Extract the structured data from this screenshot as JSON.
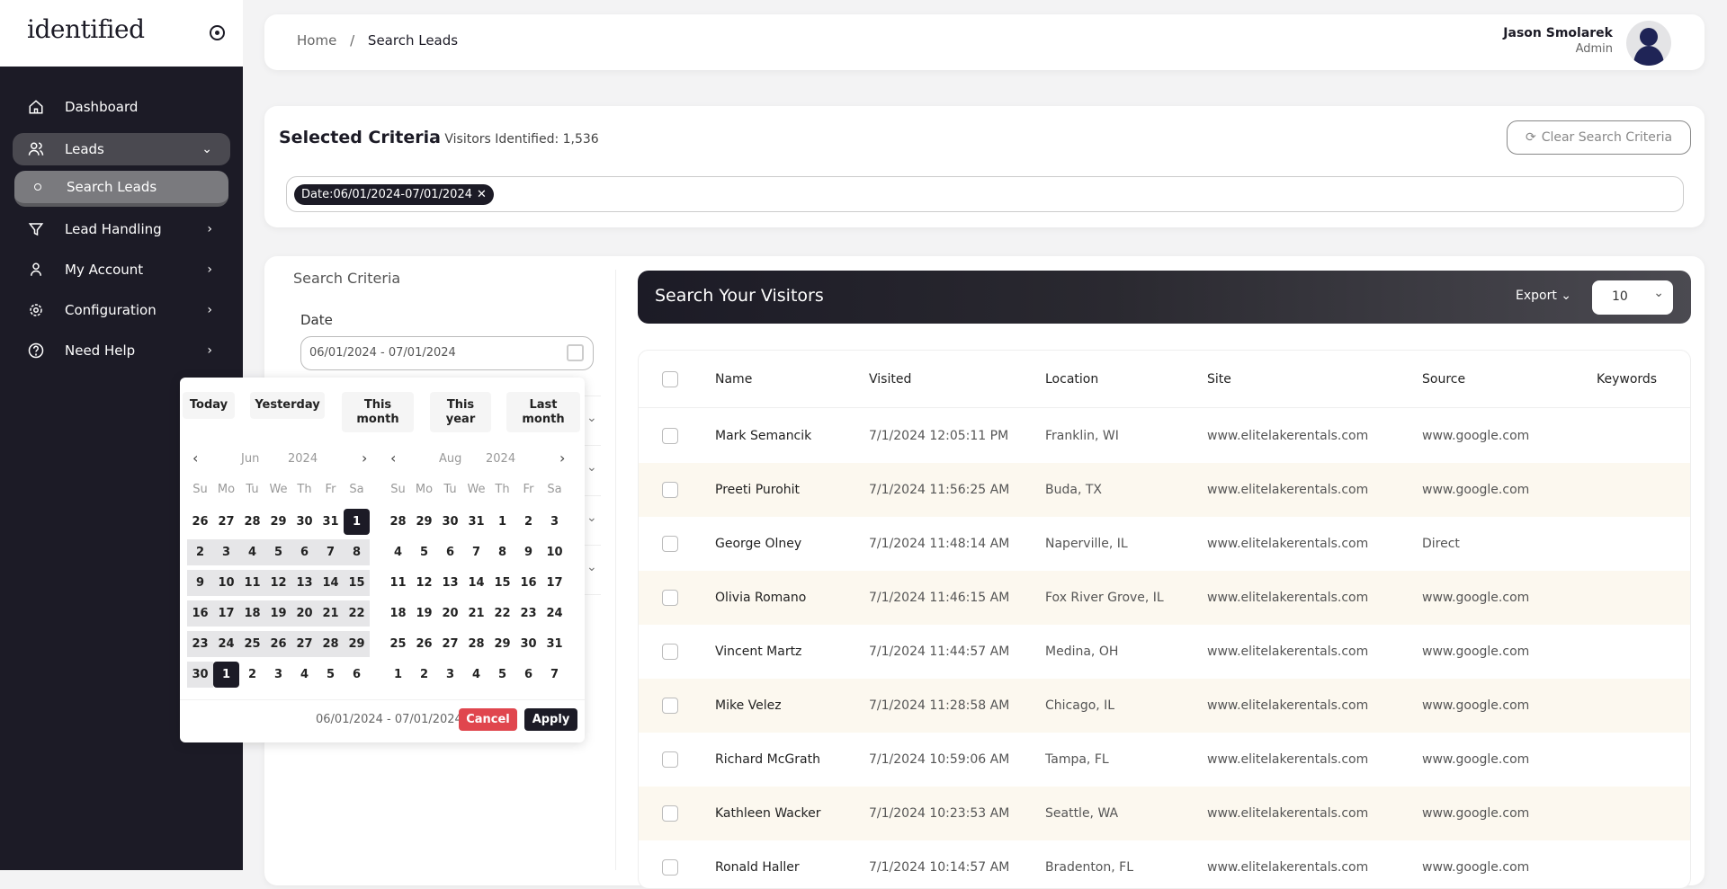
{
  "app": {
    "logo": "identified"
  },
  "sidebar": {
    "items": [
      {
        "label": "Dashboard",
        "icon": "home-icon"
      },
      {
        "label": "Leads",
        "icon": "users-icon",
        "expanded": true
      },
      {
        "label": "Search Leads",
        "icon": "circle-icon",
        "active": true
      },
      {
        "label": "Lead Handling",
        "icon": "filter-icon"
      },
      {
        "label": "My Account",
        "icon": "user-icon"
      },
      {
        "label": "Configuration",
        "icon": "gear-icon"
      },
      {
        "label": "Need Help",
        "icon": "help-icon"
      }
    ]
  },
  "header": {
    "breadcrumb": [
      "Home",
      "Search Leads"
    ],
    "separator": "/",
    "user_name": "Jason Smolarek",
    "user_role": "Admin"
  },
  "criteria": {
    "title": "Selected Criteria",
    "count_label": "Visitors Identified: 1,536",
    "clear_label": "Clear Search Criteria",
    "chips": [
      {
        "label": "Date:06/01/2024-07/01/2024",
        "remove": "✕"
      }
    ]
  },
  "search_panel": {
    "title": "Search Criteria",
    "date_label": "Date",
    "date_value": "06/01/2024 - 07/01/2024"
  },
  "datepicker": {
    "presets": [
      "Today",
      "Yesterday",
      "This month",
      "This year",
      "Last month"
    ],
    "weekdays": [
      "Su",
      "Mo",
      "Tu",
      "We",
      "Th",
      "Fr",
      "Sa"
    ],
    "calendars": [
      {
        "month": "Jun",
        "year": "2024",
        "weeks": [
          [
            26,
            27,
            28,
            29,
            30,
            31,
            1
          ],
          [
            2,
            3,
            4,
            5,
            6,
            7,
            8
          ],
          [
            9,
            10,
            11,
            12,
            13,
            14,
            15
          ],
          [
            16,
            17,
            18,
            19,
            20,
            21,
            22
          ],
          [
            23,
            24,
            25,
            26,
            27,
            28,
            29
          ],
          [
            30,
            1,
            2,
            3,
            4,
            5,
            6
          ]
        ]
      },
      {
        "month": "Aug",
        "year": "2024",
        "weeks": [
          [
            28,
            29,
            30,
            31,
            1,
            2,
            3
          ],
          [
            4,
            5,
            6,
            7,
            8,
            9,
            10
          ],
          [
            11,
            12,
            13,
            14,
            15,
            16,
            17
          ],
          [
            18,
            19,
            20,
            21,
            22,
            23,
            24
          ],
          [
            25,
            26,
            27,
            28,
            29,
            30,
            31
          ],
          [
            1,
            2,
            3,
            4,
            5,
            6,
            7
          ]
        ]
      }
    ],
    "range_start": "2024-06-01",
    "range_end": "2024-07-01",
    "range_text": "06/01/2024 - 07/01/2024",
    "cancel_label": "Cancel",
    "apply_label": "Apply",
    "colors": {
      "cancel": "#e0464e",
      "apply": "#1c1b26"
    }
  },
  "visitors": {
    "title": "Search Your Visitors",
    "export_label": "Export",
    "page_size": "10",
    "columns": [
      "Name",
      "Visited",
      "Location",
      "Site",
      "Source",
      "Keywords"
    ],
    "rows": [
      [
        "Mark Semancik",
        "7/1/2024 12:05:11 PM",
        "Franklin, WI",
        "www.elitelakerentals.com",
        "www.google.com",
        ""
      ],
      [
        "Preeti Purohit",
        "7/1/2024 11:56:25 AM",
        "Buda, TX",
        "www.elitelakerentals.com",
        "www.google.com",
        ""
      ],
      [
        "George Olney",
        "7/1/2024 11:48:14 AM",
        "Naperville, IL",
        "www.elitelakerentals.com",
        "Direct",
        ""
      ],
      [
        "Olivia Romano",
        "7/1/2024 11:46:15 AM",
        "Fox River Grove, IL",
        "www.elitelakerentals.com",
        "www.google.com",
        ""
      ],
      [
        "Vincent Martz",
        "7/1/2024 11:44:57 AM",
        "Medina, OH",
        "www.elitelakerentals.com",
        "www.google.com",
        ""
      ],
      [
        "Mike Velez",
        "7/1/2024 11:28:58 AM",
        "Chicago, IL",
        "www.elitelakerentals.com",
        "www.google.com",
        ""
      ],
      [
        "Richard McGrath",
        "7/1/2024 10:59:06 AM",
        "Tampa, FL",
        "www.elitelakerentals.com",
        "www.google.com",
        ""
      ],
      [
        "Kathleen Wacker",
        "7/1/2024 10:23:53 AM",
        "Seattle, WA",
        "www.elitelakerentals.com",
        "www.google.com",
        ""
      ],
      [
        "Ronald Haller",
        "7/1/2024 10:14:57 AM",
        "Bradenton, FL",
        "www.elitelakerentals.com",
        "www.google.com",
        ""
      ]
    ]
  },
  "colors": {
    "sidebar": "#1c1b26",
    "row_stripe": "#fcf8ef",
    "accent": "#1c1b26"
  }
}
